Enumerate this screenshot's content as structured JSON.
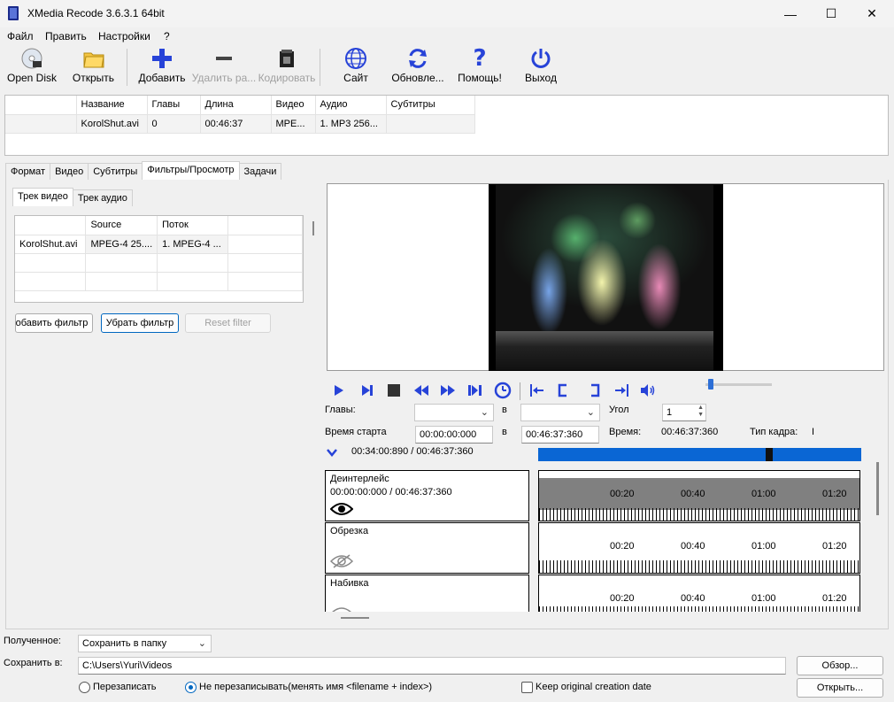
{
  "window": {
    "title": "XMedia Recode 3.6.3.1 64bit"
  },
  "menu": [
    "Файл",
    "Править",
    "Настройки",
    "?"
  ],
  "toolbar": {
    "open_disk": "Open Disk",
    "open": "Открыть",
    "add": "Добавить",
    "remove": "Удалить ра...",
    "encode": "Кодировать",
    "site": "Сайт",
    "update": "Обновле...",
    "help": "Помощь!",
    "exit": "Выход"
  },
  "file_list": {
    "columns": [
      "Название",
      "Главы",
      "Длина",
      "Видео",
      "Аудио",
      "Субтитры"
    ],
    "rows": [
      [
        "KorolShut.avi",
        "0",
        "00:46:37",
        "MPE...",
        "1. MP3 256...",
        ""
      ]
    ]
  },
  "main_tabs": [
    "Формат",
    "Видео",
    "Субтитры",
    "Фильтры/Просмотр",
    "Задачи"
  ],
  "sub_tabs": [
    "Трек видео",
    "Трек аудио"
  ],
  "track_list": {
    "columns": [
      "",
      "Source",
      "Поток"
    ],
    "rows": [
      [
        "KorolShut.avi",
        "MPEG-4 25....",
        "1. MPEG-4 ..."
      ]
    ]
  },
  "filter_buttons": {
    "add": "Добавить фильтр",
    "remove": "Убрать фильтр",
    "reset": "Reset filter"
  },
  "preview": {
    "chapters_label": "Главы:",
    "in_label_1": "в",
    "angle_label": "Угол",
    "angle_value": "1",
    "start_label": "Время старта",
    "start_value": "00:00:00:000",
    "in_label_2": "в",
    "end_value": "00:46:37:360",
    "time_label": "Время:",
    "time_value": "00:46:37:360",
    "frame_type_label": "Тип кадра:",
    "frame_type_value": "I",
    "position": "00:34:00:890 / 00:46:37:360",
    "progress": 0.72
  },
  "filters": [
    {
      "name": "Деинтерлейс",
      "range": "00:00:00:000 / 00:46:37:360",
      "enabled": true
    },
    {
      "name": "Обрезка",
      "range": "",
      "enabled": false
    },
    {
      "name": "Набивка",
      "range": "",
      "enabled": false
    }
  ],
  "timeline_labels": [
    "00:20",
    "00:40",
    "01:00",
    "01:20"
  ],
  "output": {
    "received_label": "Полученное:",
    "received_value": "Сохранить в папку",
    "save_label": "Сохранить в:",
    "save_path": "C:\\Users\\Yuri\\Videos",
    "browse": "Обзор...",
    "open": "Открыть...",
    "overwrite": "Перезаписать",
    "no_overwrite": "Не перезаписывать(менять имя <filename + index>)",
    "keep_date": "Keep original creation date"
  }
}
